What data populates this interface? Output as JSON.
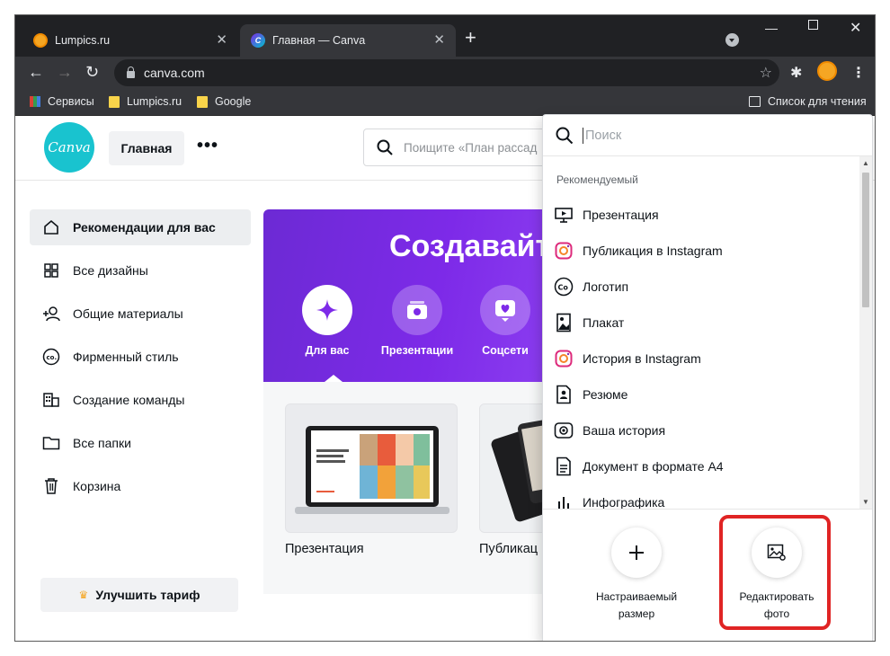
{
  "browser": {
    "tabs": [
      {
        "title": "Lumpics.ru",
        "favicon": "lumpics-orange-icon"
      },
      {
        "title": "Главная — Canva",
        "favicon": "canva-icon",
        "active": true
      }
    ],
    "url": "canva.com",
    "bookmarks": [
      "Сервисы",
      "Lumpics.ru",
      "Google"
    ],
    "reading_list": "Список для чтения"
  },
  "canva": {
    "logo_text": "Canva",
    "home_button": "Главная",
    "more": "•••",
    "search_placeholder": "Поищите «План рассад",
    "sidebar": [
      {
        "label": "Рекомендации для вас",
        "icon": "home-icon",
        "active": true
      },
      {
        "label": "Все дизайны",
        "icon": "grid-icon"
      },
      {
        "label": "Общие материалы",
        "icon": "shared-users-icon"
      },
      {
        "label": "Фирменный стиль",
        "icon": "brand-kit-icon"
      },
      {
        "label": "Создание команды",
        "icon": "team-building-icon"
      },
      {
        "label": "Все папки",
        "icon": "folder-icon"
      },
      {
        "label": "Корзина",
        "icon": "trash-icon"
      }
    ],
    "upgrade_button": "Улучшить тариф",
    "hero_title": "Создавайт",
    "categories": [
      {
        "label": "Для вас",
        "icon": "sparkle-icon"
      },
      {
        "label": "Презентации",
        "icon": "presentation-icon"
      },
      {
        "label": "Соцсети",
        "icon": "heart-icon"
      }
    ],
    "cards": [
      {
        "label": "Презентация"
      },
      {
        "label": "Публикац"
      }
    ]
  },
  "dropdown": {
    "search_placeholder": "Поиск",
    "section_title": "Рекомендуемый",
    "items": [
      {
        "label": "Презентация",
        "icon": "presentation-icon"
      },
      {
        "label": "Публикация в Instagram",
        "icon": "instagram-icon"
      },
      {
        "label": "Логотип",
        "icon": "logo-co-icon"
      },
      {
        "label": "Плакат",
        "icon": "poster-icon"
      },
      {
        "label": "История в Instagram",
        "icon": "instagram-icon"
      },
      {
        "label": "Резюме",
        "icon": "resume-icon"
      },
      {
        "label": "Ваша история",
        "icon": "story-icon"
      },
      {
        "label": "Документ в формате A4",
        "icon": "document-icon"
      },
      {
        "label": "Инфографика",
        "icon": "infographic-icon"
      }
    ],
    "actions": [
      {
        "label_line1": "Настраиваемый",
        "label_line2": "размер",
        "icon": "plus-icon"
      },
      {
        "label_line1": "Редактировать",
        "label_line2": "фото",
        "icon": "edit-photo-icon",
        "highlighted": true
      }
    ],
    "highlight_color": "#e02424"
  },
  "colors": {
    "canva_teal": "#19c3cf",
    "hero_purple": "#7d2ae8",
    "chrome_dark": "#202124"
  }
}
